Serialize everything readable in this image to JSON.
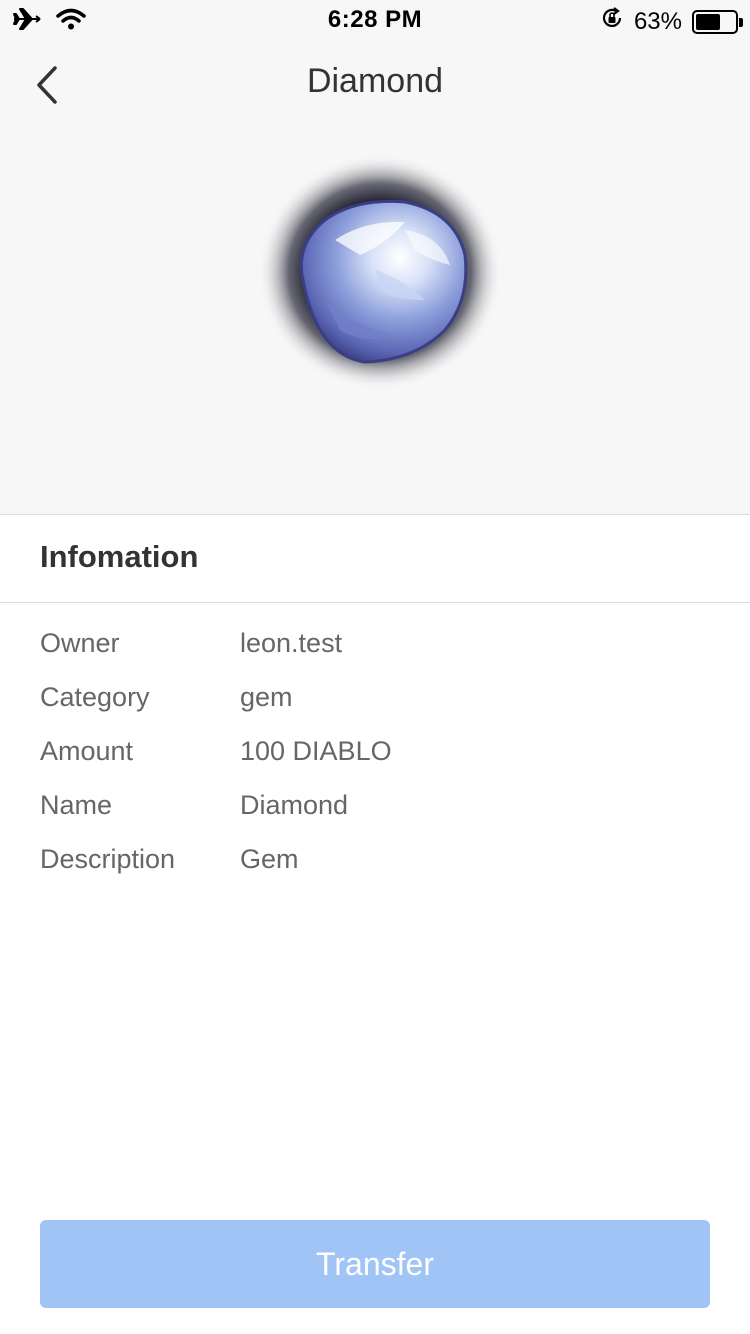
{
  "status_bar": {
    "time": "6:28 PM",
    "battery_percent": "63%",
    "battery_level": 0.63,
    "icons": [
      "airplane-icon",
      "wifi-icon",
      "rotation-lock-icon",
      "battery-icon"
    ]
  },
  "nav": {
    "title": "Diamond",
    "back_icon": "chevron-left-icon"
  },
  "item_image": {
    "icon": "diamond-gem-icon"
  },
  "info": {
    "header": "Infomation",
    "rows": [
      {
        "label": "Owner",
        "value": "leon.test"
      },
      {
        "label": "Category",
        "value": "gem"
      },
      {
        "label": "Amount",
        "value": "100 DIABLO"
      },
      {
        "label": "Name",
        "value": "Diamond"
      },
      {
        "label": "Description",
        "value": "Gem"
      }
    ]
  },
  "actions": {
    "transfer_label": "Transfer"
  },
  "colors": {
    "top_background": "#f7f7f7",
    "button_background": "#a0c4f5",
    "label_text": "#666666",
    "title_text": "#333333"
  }
}
